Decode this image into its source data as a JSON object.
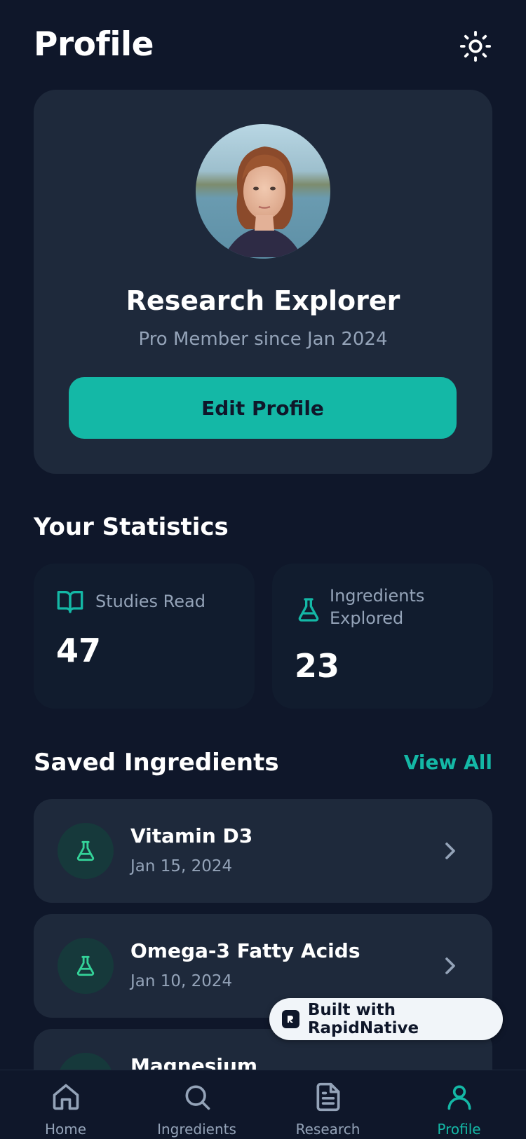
{
  "header": {
    "title": "Profile",
    "theme_icon": "sun-icon"
  },
  "profile": {
    "name": "Research Explorer",
    "subtitle": "Pro Member since Jan 2024",
    "edit_label": "Edit Profile"
  },
  "statistics": {
    "title": "Your Statistics",
    "cards": [
      {
        "icon": "book-open-icon",
        "label": "Studies Read",
        "value": "47"
      },
      {
        "icon": "flask-icon",
        "label_line1": "Ingredients",
        "label_line2": "Explored",
        "value": "23"
      }
    ]
  },
  "saved": {
    "title": "Saved Ingredients",
    "view_all": "View All",
    "items": [
      {
        "name": "Vitamin D3",
        "date": "Jan 15, 2024"
      },
      {
        "name": "Omega-3 Fatty Acids",
        "date": "Jan 10, 2024"
      },
      {
        "name": "Magnesium",
        "date": ""
      }
    ]
  },
  "badge": {
    "label": "Built with RapidNative"
  },
  "nav": {
    "items": [
      {
        "label": "Home",
        "icon": "home-icon"
      },
      {
        "label": "Ingredients",
        "icon": "search-icon"
      },
      {
        "label": "Research",
        "icon": "document-icon"
      },
      {
        "label": "Profile",
        "icon": "user-icon"
      }
    ],
    "active": "Profile"
  },
  "colors": {
    "background": "#0f172a",
    "card": "#1e293b",
    "accent": "#14b8a6",
    "muted_text": "#94a3b8"
  }
}
